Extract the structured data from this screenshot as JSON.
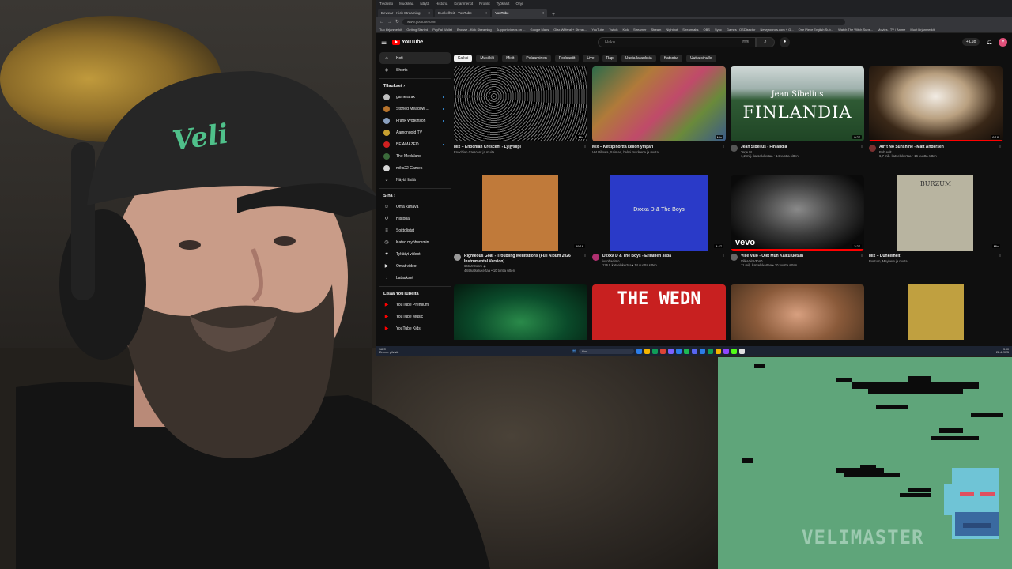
{
  "browser": {
    "menu": [
      "Tiedosto",
      "Muokkaa",
      "Näytä",
      "Historia",
      "Kirjanmerkit",
      "Profiilit",
      "Työkalut",
      "Ohje"
    ],
    "tabs": [
      {
        "title": "Bewear - Kick Streaming",
        "active": false
      },
      {
        "title": "Dunkelheit - YouTube",
        "active": false
      },
      {
        "title": "YouTube",
        "active": true
      }
    ],
    "url": "www.youtube.com",
    "bookmarks": [
      "Tuo kirjanmerkit",
      "Getting Started",
      "PayPal Wallet",
      "Browse - Kick Streaming",
      "Support videos on ...",
      "Google Maps",
      "Glax Wilferal + Streak...",
      "YouTube",
      "Twitch",
      "Kick",
      "Streamer",
      "Stream",
      "Nightbot",
      "Streamlabs",
      "OBS",
      "Sync",
      "Games | OSDisector",
      "Newgrounds.com + G...",
      "One Piece English Sub...",
      "Watch The Witch Subs...",
      "Movies / TV / Anime",
      "Muut kirjanmerkit"
    ]
  },
  "youtube": {
    "logo_text": "YouTube",
    "search_placeholder": "Haku",
    "create_label": "+ Luo",
    "avatar_letter": "V",
    "sidebar": {
      "main": [
        {
          "label": "Koti",
          "icon": "home-icon",
          "glyph": "⌂",
          "active": true
        },
        {
          "label": "Shorts",
          "icon": "shorts-icon",
          "glyph": "◈",
          "active": false
        }
      ],
      "subs_header": "Tilaukset  ›",
      "subscriptions": [
        {
          "label": "gamerarax",
          "color": "#c0c0c0",
          "dot": true
        },
        {
          "label": "Stoned Meadow ...",
          "color": "#b8742c",
          "dot": true
        },
        {
          "label": "Frank Wotkinson",
          "color": "#8aa0c0",
          "dot": true
        },
        {
          "label": "Aamongold TV",
          "color": "#c8a030",
          "dot": false
        },
        {
          "label": "BE AMAZED",
          "color": "#d02020",
          "dot": true
        },
        {
          "label": "The Medaland",
          "color": "#3a6a3a",
          "dot": false
        },
        {
          "label": "mikc22 Games",
          "color": "#d8d8d8",
          "dot": false
        }
      ],
      "show_more": "Näytä lisää",
      "you_header": "Sinä  ›",
      "you_items": [
        {
          "label": "Oma kanava",
          "glyph": "☺",
          "icon": "channel-icon"
        },
        {
          "label": "Historia",
          "glyph": "↺",
          "icon": "history-icon"
        },
        {
          "label": "Soittolistat",
          "glyph": "≡",
          "icon": "playlists-icon"
        },
        {
          "label": "Katso myöhemmin",
          "glyph": "◷",
          "icon": "watch-later-icon"
        },
        {
          "label": "Tykätyt videot",
          "glyph": "♥",
          "icon": "liked-icon"
        },
        {
          "label": "Omat videot",
          "glyph": "▶",
          "icon": "my-videos-icon"
        },
        {
          "label": "Lataukset",
          "glyph": "↓",
          "icon": "downloads-icon"
        }
      ],
      "more_header": "Lisää YouTubelta",
      "more_items": [
        {
          "label": "YouTube Premium",
          "color": "#ff0000"
        },
        {
          "label": "YouTube Music",
          "color": "#ff0000"
        },
        {
          "label": "YouTube Kids",
          "color": "#ff0000"
        }
      ]
    },
    "chips": [
      "Kaikki",
      "Musiikki",
      "Mixit",
      "Pelaaminen",
      "Podcastit",
      "Live",
      "Rap",
      "Uusia latauksia",
      "Katsotut",
      "Uutta sinulle"
    ],
    "videos": [
      {
        "title": "Mix – Enochian Crescent - Lyijysiipi",
        "channel": "Enochian Crescent ja muita",
        "stats": "",
        "duration": "Mix",
        "thumb": "noise",
        "avatar": "",
        "progress": 0
      },
      {
        "title": "Mix – Kettipinortta kellon ympäri",
        "channel": "Vet Pillowa, Saimaa, helmi marleena ja muita",
        "stats": "",
        "duration": "Mix",
        "thumb": "collage",
        "avatar": "",
        "progress": 0
      },
      {
        "title": "Jean Sibelius - Finlandia",
        "channel": "Terje M",
        "stats": "1,2 milj. katselukertaa • 14 vuotta sitten",
        "duration": "9:27",
        "thumb": "finlandia",
        "avatar": "#555",
        "progress": 0
      },
      {
        "title": "Ain't No Sunshine - Matt Andersen",
        "channel": "Bob Ault",
        "stats": "6,7 milj. katselukertaa • 16 vuotta sitten",
        "duration": "6:18",
        "thumb": "guitar",
        "avatar": "#7a3030",
        "progress": 1.0
      },
      {
        "title": "Righteous Goat - Troubling Meditations (Full Album 2026 Instrumental Version)",
        "channel": "666MrDoom ◉",
        "stats": "484 katselukertaa • 10 tuntia sitten",
        "duration": "59:16",
        "thumb": "goat",
        "avatar": "#999",
        "progress": 0
      },
      {
        "title": "Dxxxa D & The Boys - Erilainen Jäbä",
        "channel": "ivanhaeimo",
        "stats": "126 t. katselukertaa • 14 vuotta sitten",
        "duration": "4:47",
        "thumb": "dxxxa",
        "avatar": "#b03070",
        "progress": 0
      },
      {
        "title": "Ville Valo - Olet Mun Kaikuluotain",
        "channel": "VilleValoVEVO",
        "stats": "11 milj. katselukertaa • 10 vuotta sitten",
        "duration": "3:27",
        "thumb": "vevo",
        "avatar": "#666",
        "progress": 1.0
      },
      {
        "title": "Mix – Dunkelheit",
        "channel": "Burzum, Mayhem ja muita",
        "stats": "",
        "duration": "Mix",
        "thumb": "burzum",
        "avatar": "",
        "progress": 0
      },
      {
        "title": "",
        "channel": "",
        "stats": "",
        "duration": "",
        "thumb": "greenstage",
        "avatar": "",
        "progress": 0
      },
      {
        "title": "",
        "channel": "",
        "stats": "",
        "duration": "",
        "thumb": "letters",
        "avatar": "",
        "progress": 0
      },
      {
        "title": "",
        "channel": "",
        "stats": "",
        "duration": "",
        "thumb": "man",
        "avatar": "",
        "progress": 0
      },
      {
        "title": "",
        "channel": "",
        "stats": "",
        "duration": "",
        "thumb": "album",
        "avatar": "",
        "progress": 0
      }
    ],
    "thumb_text": {
      "finlandia_top": "Jean Sibelius",
      "finlandia_main": "FINLANDIA",
      "dxxxa": "Dxxxa D & The Boys",
      "vevo": "vevo",
      "burzum": "BURZUM",
      "letters": "THE WEDN"
    }
  },
  "taskbar": {
    "weather": "18°C\nEnimm. pilvistä",
    "search": "Hae",
    "clock": "3.00\n22.4.2025",
    "apps": [
      "#2b7de9",
      "#f4b400",
      "#0f9d58",
      "#db4437",
      "#7b61ff",
      "#2b7de9",
      "#1db954",
      "#5865f2",
      "#2b7de9",
      "#0f9d58",
      "#f4b400",
      "#9146ff",
      "#53fc18",
      "#e0e0e0"
    ]
  },
  "game": {
    "logo_text": "VELIMASTER"
  },
  "colors": {
    "yt_bg": "#0f0f0f",
    "yt_red": "#ff0000",
    "game_bg": "#5fa57a",
    "cap_logo": "#4fc08a"
  }
}
